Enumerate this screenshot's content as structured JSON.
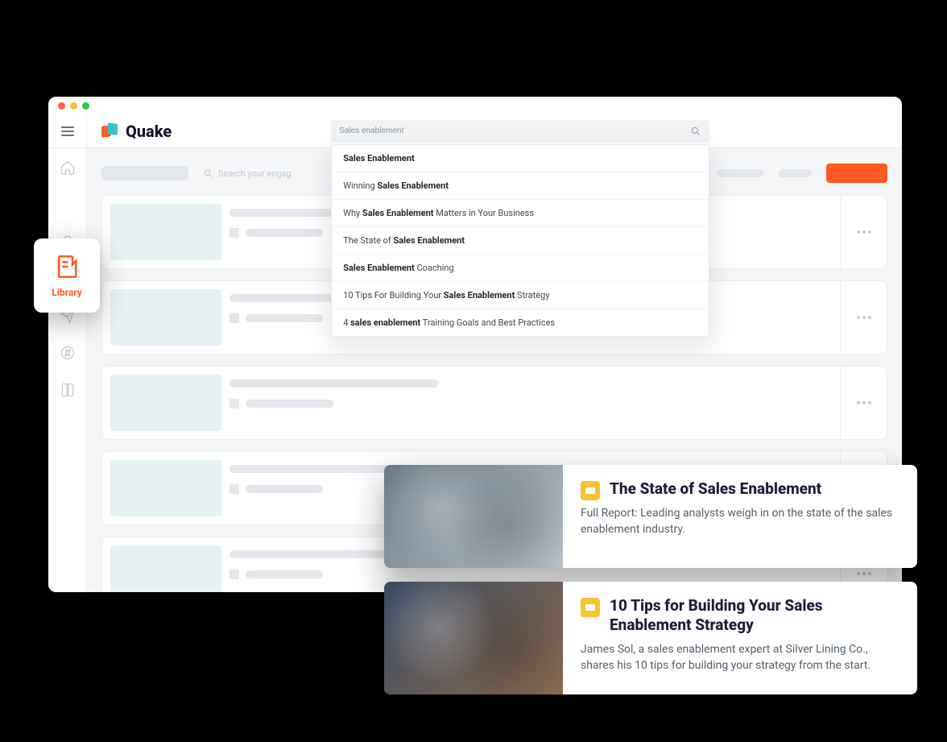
{
  "brand": {
    "name": "Quake"
  },
  "search": {
    "value": "Sales enablement",
    "suggestions": [
      {
        "pre": "",
        "bold": "Sales Enablement",
        "post": ""
      },
      {
        "pre": "Winning ",
        "bold": "Sales Enablement",
        "post": ""
      },
      {
        "pre": "Why ",
        "bold": "Sales Enablement",
        "post": " Matters in Your Business"
      },
      {
        "pre": "The State of ",
        "bold": "Sales Enablement",
        "post": ""
      },
      {
        "pre": "",
        "bold": "Sales Enablement",
        "post": " Coaching"
      },
      {
        "pre": "10 Tips For Building Your ",
        "bold": "Sales Enablement",
        "post": " Strategy"
      },
      {
        "pre": "4 ",
        "bold": "sales enablement",
        "post": " Training Goals and Best Practices"
      }
    ]
  },
  "rail": {
    "items": [
      "home",
      "library",
      "briefcase",
      "analytics",
      "send",
      "hashtag",
      "book"
    ],
    "chip_label": "Library"
  },
  "subtoolbar": {
    "search_placeholder": "Search your engag"
  },
  "previews": [
    {
      "title": "The State of Sales Enablement",
      "desc": "Full Report: Leading analysts weigh in on the state of the sales enablement industry."
    },
    {
      "title": "10 Tips for Building Your Sales Enablement Strategy",
      "desc": "James Sol, a sales enablement expert at Silver Lining Co., shares his 10 tips for building your strategy from the start."
    }
  ],
  "colors": {
    "accent": "#ff5a1f",
    "brand_teal": "#34c4c8",
    "slide_yellow": "#f7c330"
  }
}
